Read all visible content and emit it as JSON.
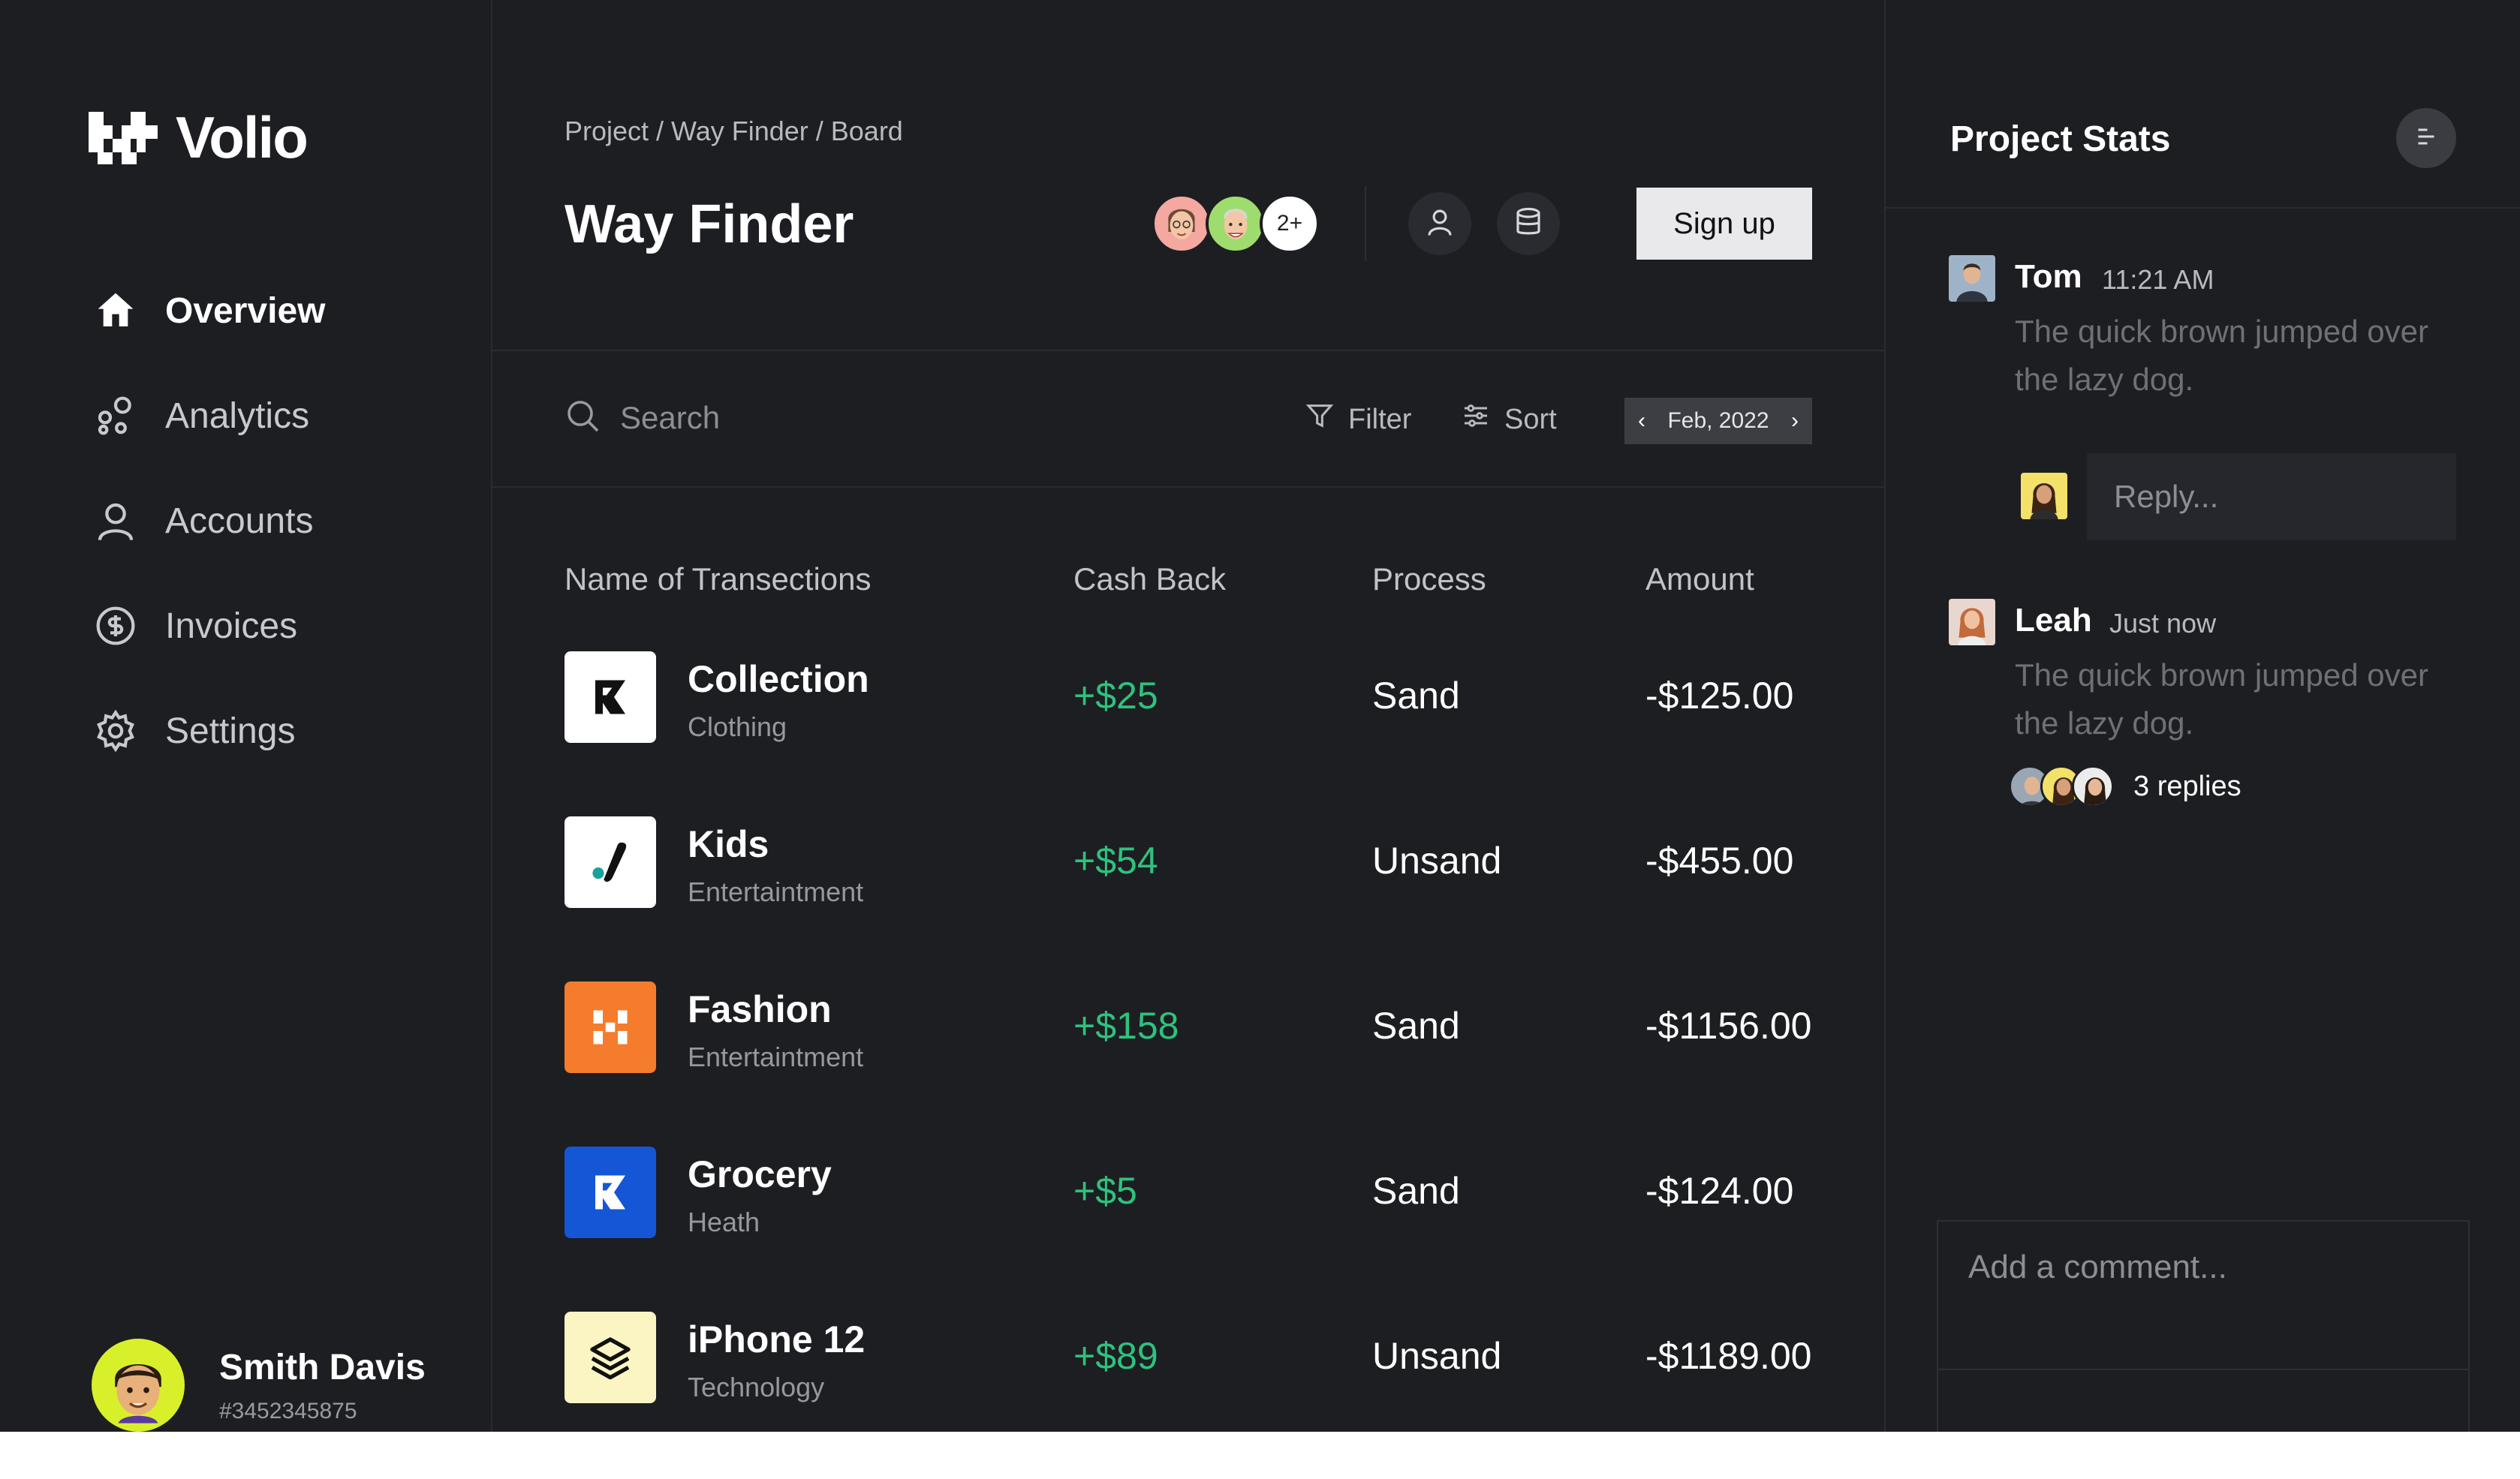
{
  "brand": {
    "name": "Volio"
  },
  "nav": {
    "items": [
      {
        "label": "Overview",
        "icon": "home-icon",
        "active": true
      },
      {
        "label": "Analytics",
        "icon": "analytics-icon",
        "active": false
      },
      {
        "label": "Accounts",
        "icon": "user-icon",
        "active": false
      },
      {
        "label": "Invoices",
        "icon": "dollar-icon",
        "active": false
      },
      {
        "label": "Settings",
        "icon": "gear-icon",
        "active": false
      }
    ]
  },
  "profile": {
    "name": "Smith Davis",
    "id": "#3452345875"
  },
  "header": {
    "breadcrumb": "Project / Way Finder / Board",
    "title": "Way Finder",
    "more_members": "2+",
    "signup_label": "Sign up"
  },
  "toolbar": {
    "search_placeholder": "Search",
    "filter_label": "Filter",
    "sort_label": "Sort",
    "date_label": "Feb, 2022"
  },
  "table": {
    "headers": [
      "Name of Transections",
      "Cash Back",
      "Process",
      "Amount"
    ],
    "rows": [
      {
        "name": "Collection",
        "category": "Clothing",
        "cashback": "+$25",
        "process": "Sand",
        "amount": "-$125.00"
      },
      {
        "name": "Kids",
        "category": "Entertaintment",
        "cashback": "+$54",
        "process": "Unsand",
        "amount": "-$455.00"
      },
      {
        "name": "Fashion",
        "category": "Entertaintment",
        "cashback": "+$158",
        "process": "Sand",
        "amount": "-$1156.00"
      },
      {
        "name": "Grocery",
        "category": "Heath",
        "cashback": "+$5",
        "process": "Sand",
        "amount": "-$124.00"
      },
      {
        "name": "iPhone 12",
        "category": "Technology",
        "cashback": "+$89",
        "process": "Unsand",
        "amount": "-$1189.00"
      }
    ]
  },
  "stats": {
    "title": "Project Stats",
    "comments": [
      {
        "name": "Tom",
        "time": "11:21 AM",
        "text": "The quick brown jumped over the lazy dog."
      },
      {
        "name": "Leah",
        "time": "Just now",
        "text": "The quick brown jumped over the lazy dog.",
        "replies": "3 replies"
      }
    ],
    "reply_placeholder": "Reply...",
    "comment_placeholder": "Add a comment..."
  },
  "colors": {
    "background": "#1d1e22",
    "positive": "#2ec27e",
    "accent_yellow": "#d8f02a",
    "orange": "#f47c2c",
    "blue": "#1456d6"
  }
}
